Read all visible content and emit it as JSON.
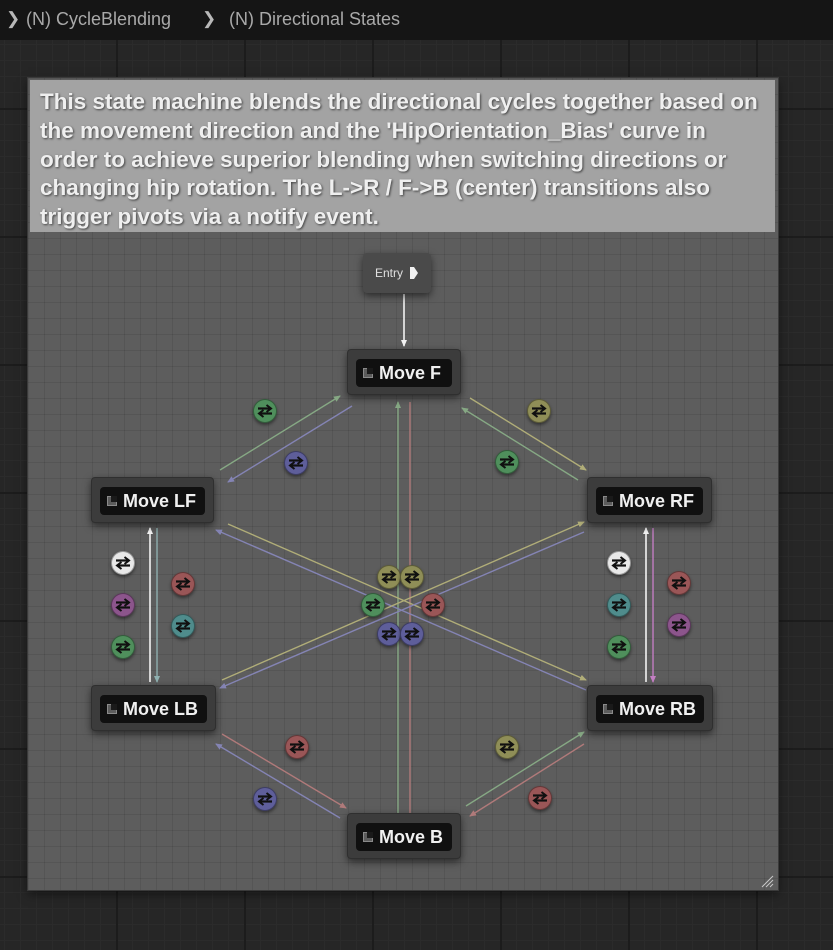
{
  "breadcrumb": {
    "items": [
      "(N) CycleBlending",
      "(N) Directional States"
    ]
  },
  "comment": {
    "text": "This state machine blends the directional cycles together based on the movement direction and the 'HipOrientation_Bias' curve in order to achieve superior blending when switching directions or changing hip rotation. The L->R / F->B (center) transitions also trigger pivots via a notify event."
  },
  "entry": {
    "label": "Entry"
  },
  "states": {
    "f": "Move F",
    "lf": "Move LF",
    "rf": "Move RF",
    "lb": "Move LB",
    "rb": "Move RB",
    "b": "Move B"
  },
  "colors": {
    "green": "#4f8f5c",
    "blue": "#5e5e9a",
    "olive": "#8f8e57",
    "red": "#9a5657",
    "teal": "#4f8c8c",
    "purple": "#8c558c",
    "white": "#e8e8e8"
  },
  "transitions": [
    {
      "id": "f-lf-1",
      "color": "green"
    },
    {
      "id": "f-lf-2",
      "color": "blue"
    },
    {
      "id": "f-rf-1",
      "color": "olive"
    },
    {
      "id": "f-rf-2",
      "color": "green"
    },
    {
      "id": "lf-lb-1",
      "color": "white"
    },
    {
      "id": "lf-lb-2",
      "color": "red"
    },
    {
      "id": "lf-lb-3",
      "color": "purple"
    },
    {
      "id": "lf-lb-4",
      "color": "teal"
    },
    {
      "id": "lf-lb-5",
      "color": "green"
    },
    {
      "id": "rf-rb-1",
      "color": "white"
    },
    {
      "id": "rf-rb-2",
      "color": "red"
    },
    {
      "id": "rf-rb-3",
      "color": "teal"
    },
    {
      "id": "rf-rb-4",
      "color": "purple"
    },
    {
      "id": "rf-rb-5",
      "color": "green"
    },
    {
      "id": "center-1",
      "color": "olive"
    },
    {
      "id": "center-2",
      "color": "olive"
    },
    {
      "id": "center-3",
      "color": "green"
    },
    {
      "id": "center-4",
      "color": "red"
    },
    {
      "id": "center-5",
      "color": "blue"
    },
    {
      "id": "center-6",
      "color": "blue"
    },
    {
      "id": "lb-b-1",
      "color": "red"
    },
    {
      "id": "lb-b-2",
      "color": "blue"
    },
    {
      "id": "rb-b-1",
      "color": "olive"
    },
    {
      "id": "rb-b-2",
      "color": "red"
    }
  ]
}
